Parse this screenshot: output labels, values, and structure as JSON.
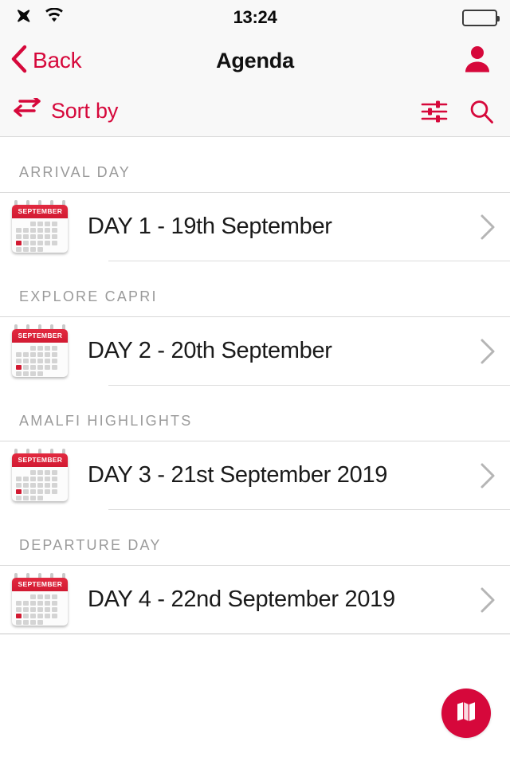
{
  "theme": {
    "accent": "#d6083b",
    "calendar_red": "#d21a32",
    "text_primary": "#1a1a1a",
    "text_muted": "#9a9a9a",
    "divider": "#d9d9d9",
    "bar_background": "#f8f8f8",
    "page_background": "#ffffff"
  },
  "status_bar": {
    "airplane_icon": "airplane-mode-icon",
    "wifi_icon": "wifi-icon",
    "time": "13:24",
    "battery_icon": "battery-full-icon",
    "battery_level": "100"
  },
  "nav_bar": {
    "back_icon": "chevron-left-icon",
    "back_label": "Back",
    "title": "Agenda",
    "profile_icon": "person-icon"
  },
  "toolbar": {
    "sort_icon": "swap-arrows-icon",
    "sort_label": "Sort by",
    "filter_icon": "filter-sliders-icon",
    "search_icon": "search-icon"
  },
  "sections": [
    {
      "header": "ARRIVAL DAY",
      "row": {
        "icon": "calendar-icon",
        "calendar_month": "SEPTEMBER",
        "title": "DAY 1 - 19th September",
        "chevron": "chevron-right-icon",
        "separator_inset": true
      }
    },
    {
      "header": "EXPLORE CAPRI",
      "row": {
        "icon": "calendar-icon",
        "calendar_month": "SEPTEMBER",
        "title": "DAY 2 - 20th September",
        "chevron": "chevron-right-icon",
        "separator_inset": true
      }
    },
    {
      "header": "AMALFI HIGHLIGHTS",
      "row": {
        "icon": "calendar-icon",
        "calendar_month": "SEPTEMBER",
        "title": "DAY 3 - 21st September 2019",
        "chevron": "chevron-right-icon",
        "separator_inset": true
      }
    },
    {
      "header": "DEPARTURE DAY",
      "row": {
        "icon": "calendar-icon",
        "calendar_month": "SEPTEMBER",
        "title": "DAY 4 - 22nd September 2019",
        "chevron": "chevron-right-icon",
        "separator_inset": false
      }
    }
  ],
  "fab": {
    "icon": "map-icon"
  }
}
